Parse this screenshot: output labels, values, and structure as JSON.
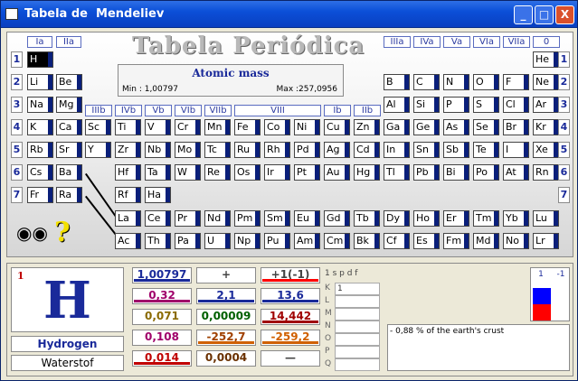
{
  "window": {
    "title": "Tabela de  Mendeliev",
    "min": "_",
    "max": "□",
    "close": "X"
  },
  "header": {
    "title": "Tabela Periódica",
    "mass_label": "Atomic mass",
    "mass_min": "Min : 1,00797",
    "mass_max": "Max :257,0956"
  },
  "groups": {
    "IA": "Ia",
    "IIA": "IIa",
    "IIIB": "IIIb",
    "IVB": "IVb",
    "VB": "Vb",
    "VIB": "VIb",
    "VIIB": "VIIb",
    "VIII": "VIII",
    "IB": "Ib",
    "IIB": "IIb",
    "IIIA": "IIIa",
    "IVA": "IVa",
    "VA": "Va",
    "VIA": "VIa",
    "VIIA": "VIIa",
    "ZERO": "0"
  },
  "periods": [
    "1",
    "2",
    "3",
    "4",
    "5",
    "6",
    "7"
  ],
  "elements": [
    {
      "s": "H",
      "r": 1,
      "c": 1
    },
    {
      "s": "He",
      "r": 1,
      "c": 18
    },
    {
      "s": "Li",
      "r": 2,
      "c": 1
    },
    {
      "s": "Be",
      "r": 2,
      "c": 2
    },
    {
      "s": "B",
      "r": 2,
      "c": 13
    },
    {
      "s": "C",
      "r": 2,
      "c": 14
    },
    {
      "s": "N",
      "r": 2,
      "c": 15
    },
    {
      "s": "O",
      "r": 2,
      "c": 16
    },
    {
      "s": "F",
      "r": 2,
      "c": 17
    },
    {
      "s": "Ne",
      "r": 2,
      "c": 18
    },
    {
      "s": "Na",
      "r": 3,
      "c": 1
    },
    {
      "s": "Mg",
      "r": 3,
      "c": 2
    },
    {
      "s": "Al",
      "r": 3,
      "c": 13
    },
    {
      "s": "Si",
      "r": 3,
      "c": 14
    },
    {
      "s": "P",
      "r": 3,
      "c": 15
    },
    {
      "s": "S",
      "r": 3,
      "c": 16
    },
    {
      "s": "Cl",
      "r": 3,
      "c": 17
    },
    {
      "s": "Ar",
      "r": 3,
      "c": 18
    },
    {
      "s": "K",
      "r": 4,
      "c": 1
    },
    {
      "s": "Ca",
      "r": 4,
      "c": 2
    },
    {
      "s": "Sc",
      "r": 4,
      "c": 3
    },
    {
      "s": "Ti",
      "r": 4,
      "c": 4
    },
    {
      "s": "V",
      "r": 4,
      "c": 5
    },
    {
      "s": "Cr",
      "r": 4,
      "c": 6
    },
    {
      "s": "Mn",
      "r": 4,
      "c": 7
    },
    {
      "s": "Fe",
      "r": 4,
      "c": 8
    },
    {
      "s": "Co",
      "r": 4,
      "c": 9
    },
    {
      "s": "Ni",
      "r": 4,
      "c": 10
    },
    {
      "s": "Cu",
      "r": 4,
      "c": 11
    },
    {
      "s": "Zn",
      "r": 4,
      "c": 12
    },
    {
      "s": "Ga",
      "r": 4,
      "c": 13
    },
    {
      "s": "Ge",
      "r": 4,
      "c": 14
    },
    {
      "s": "As",
      "r": 4,
      "c": 15
    },
    {
      "s": "Se",
      "r": 4,
      "c": 16
    },
    {
      "s": "Br",
      "r": 4,
      "c": 17
    },
    {
      "s": "Kr",
      "r": 4,
      "c": 18
    },
    {
      "s": "Rb",
      "r": 5,
      "c": 1
    },
    {
      "s": "Sr",
      "r": 5,
      "c": 2
    },
    {
      "s": "Y",
      "r": 5,
      "c": 3
    },
    {
      "s": "Zr",
      "r": 5,
      "c": 4
    },
    {
      "s": "Nb",
      "r": 5,
      "c": 5
    },
    {
      "s": "Mo",
      "r": 5,
      "c": 6
    },
    {
      "s": "Tc",
      "r": 5,
      "c": 7
    },
    {
      "s": "Ru",
      "r": 5,
      "c": 8
    },
    {
      "s": "Rh",
      "r": 5,
      "c": 9
    },
    {
      "s": "Pd",
      "r": 5,
      "c": 10
    },
    {
      "s": "Ag",
      "r": 5,
      "c": 11
    },
    {
      "s": "Cd",
      "r": 5,
      "c": 12
    },
    {
      "s": "In",
      "r": 5,
      "c": 13
    },
    {
      "s": "Sn",
      "r": 5,
      "c": 14
    },
    {
      "s": "Sb",
      "r": 5,
      "c": 15
    },
    {
      "s": "Te",
      "r": 5,
      "c": 16
    },
    {
      "s": "I",
      "r": 5,
      "c": 17
    },
    {
      "s": "Xe",
      "r": 5,
      "c": 18
    },
    {
      "s": "Cs",
      "r": 6,
      "c": 1
    },
    {
      "s": "Ba",
      "r": 6,
      "c": 2
    },
    {
      "s": "Hf",
      "r": 6,
      "c": 4
    },
    {
      "s": "Ta",
      "r": 6,
      "c": 5
    },
    {
      "s": "W",
      "r": 6,
      "c": 6
    },
    {
      "s": "Re",
      "r": 6,
      "c": 7
    },
    {
      "s": "Os",
      "r": 6,
      "c": 8
    },
    {
      "s": "Ir",
      "r": 6,
      "c": 9
    },
    {
      "s": "Pt",
      "r": 6,
      "c": 10
    },
    {
      "s": "Au",
      "r": 6,
      "c": 11
    },
    {
      "s": "Hg",
      "r": 6,
      "c": 12
    },
    {
      "s": "Tl",
      "r": 6,
      "c": 13
    },
    {
      "s": "Pb",
      "r": 6,
      "c": 14
    },
    {
      "s": "Bi",
      "r": 6,
      "c": 15
    },
    {
      "s": "Po",
      "r": 6,
      "c": 16
    },
    {
      "s": "At",
      "r": 6,
      "c": 17
    },
    {
      "s": "Rn",
      "r": 6,
      "c": 18
    },
    {
      "s": "Fr",
      "r": 7,
      "c": 1
    },
    {
      "s": "Ra",
      "r": 7,
      "c": 2
    },
    {
      "s": "Rf",
      "r": 7,
      "c": 4
    },
    {
      "s": "Ha",
      "r": 7,
      "c": 5
    },
    {
      "s": "La",
      "r": 8,
      "c": 4
    },
    {
      "s": "Ce",
      "r": 8,
      "c": 5
    },
    {
      "s": "Pr",
      "r": 8,
      "c": 6
    },
    {
      "s": "Nd",
      "r": 8,
      "c": 7
    },
    {
      "s": "Pm",
      "r": 8,
      "c": 8
    },
    {
      "s": "Sm",
      "r": 8,
      "c": 9
    },
    {
      "s": "Eu",
      "r": 8,
      "c": 10
    },
    {
      "s": "Gd",
      "r": 8,
      "c": 11
    },
    {
      "s": "Tb",
      "r": 8,
      "c": 12
    },
    {
      "s": "Dy",
      "r": 8,
      "c": 13
    },
    {
      "s": "Ho",
      "r": 8,
      "c": 14
    },
    {
      "s": "Er",
      "r": 8,
      "c": 15
    },
    {
      "s": "Tm",
      "r": 8,
      "c": 16
    },
    {
      "s": "Yb",
      "r": 8,
      "c": 17
    },
    {
      "s": "Lu",
      "r": 8,
      "c": 18
    },
    {
      "s": "Ac",
      "r": 9,
      "c": 4
    },
    {
      "s": "Th",
      "r": 9,
      "c": 5
    },
    {
      "s": "Pa",
      "r": 9,
      "c": 6
    },
    {
      "s": "U",
      "r": 9,
      "c": 7
    },
    {
      "s": "Np",
      "r": 9,
      "c": 8
    },
    {
      "s": "Pu",
      "r": 9,
      "c": 9
    },
    {
      "s": "Am",
      "r": 9,
      "c": 10
    },
    {
      "s": "Cm",
      "r": 9,
      "c": 11
    },
    {
      "s": "Bk",
      "r": 9,
      "c": 12
    },
    {
      "s": "Cf",
      "r": 9,
      "c": 13
    },
    {
      "s": "Es",
      "r": 9,
      "c": 14
    },
    {
      "s": "Fm",
      "r": 9,
      "c": 15
    },
    {
      "s": "Md",
      "r": 9,
      "c": 16
    },
    {
      "s": "No",
      "r": 9,
      "c": 17
    },
    {
      "s": "Lr",
      "r": 9,
      "c": 18
    }
  ],
  "selected": {
    "number": "1",
    "symbol": "H",
    "name": "Hydrogen",
    "local_name": "Waterstof"
  },
  "properties": [
    {
      "v": "1,00797",
      "color": "#1a2a9a",
      "ul": "#1a2a9a"
    },
    {
      "v": "+",
      "color": "#444444",
      "ul": ""
    },
    {
      "v": "+1(-1)",
      "color": "#444444",
      "ul": "#ff0000"
    },
    {
      "v": "0,32",
      "color": "#a0006a",
      "ul": "#a0006a"
    },
    {
      "v": "2,1",
      "color": "#1a2a9a",
      "ul": "#1a2a9a"
    },
    {
      "v": "13,6",
      "color": "#1a2a9a",
      "ul": "#1a2a9a"
    },
    {
      "v": "0,071",
      "color": "#8a6a00",
      "ul": ""
    },
    {
      "v": "0,00009",
      "color": "#006000",
      "ul": ""
    },
    {
      "v": "14,442",
      "color": "#a00000",
      "ul": "#a00000"
    },
    {
      "v": "0,108",
      "color": "#a0006a",
      "ul": ""
    },
    {
      "v": "-252,7",
      "color": "#a04000",
      "ul": "#d06000"
    },
    {
      "v": "-259,2",
      "color": "#d06000",
      "ul": "#d06000"
    },
    {
      "v": "0,014",
      "color": "#c00000",
      "ul": "#c00000"
    },
    {
      "v": "0,0004",
      "color": "#6a3000",
      "ul": ""
    },
    {
      "v": "—",
      "color": "#444444",
      "ul": ""
    }
  ],
  "shells": {
    "header": "1  s p d f",
    "labels": [
      "K",
      "L",
      "M",
      "N",
      "O",
      "P",
      "Q"
    ],
    "K_value": "1"
  },
  "oxidation": {
    "plus": "1",
    "minus": "-1"
  },
  "note": "- 0,88 % of the earth's crust",
  "icons": {
    "binoculars": "binoculars-icon",
    "help": "question-icon"
  }
}
